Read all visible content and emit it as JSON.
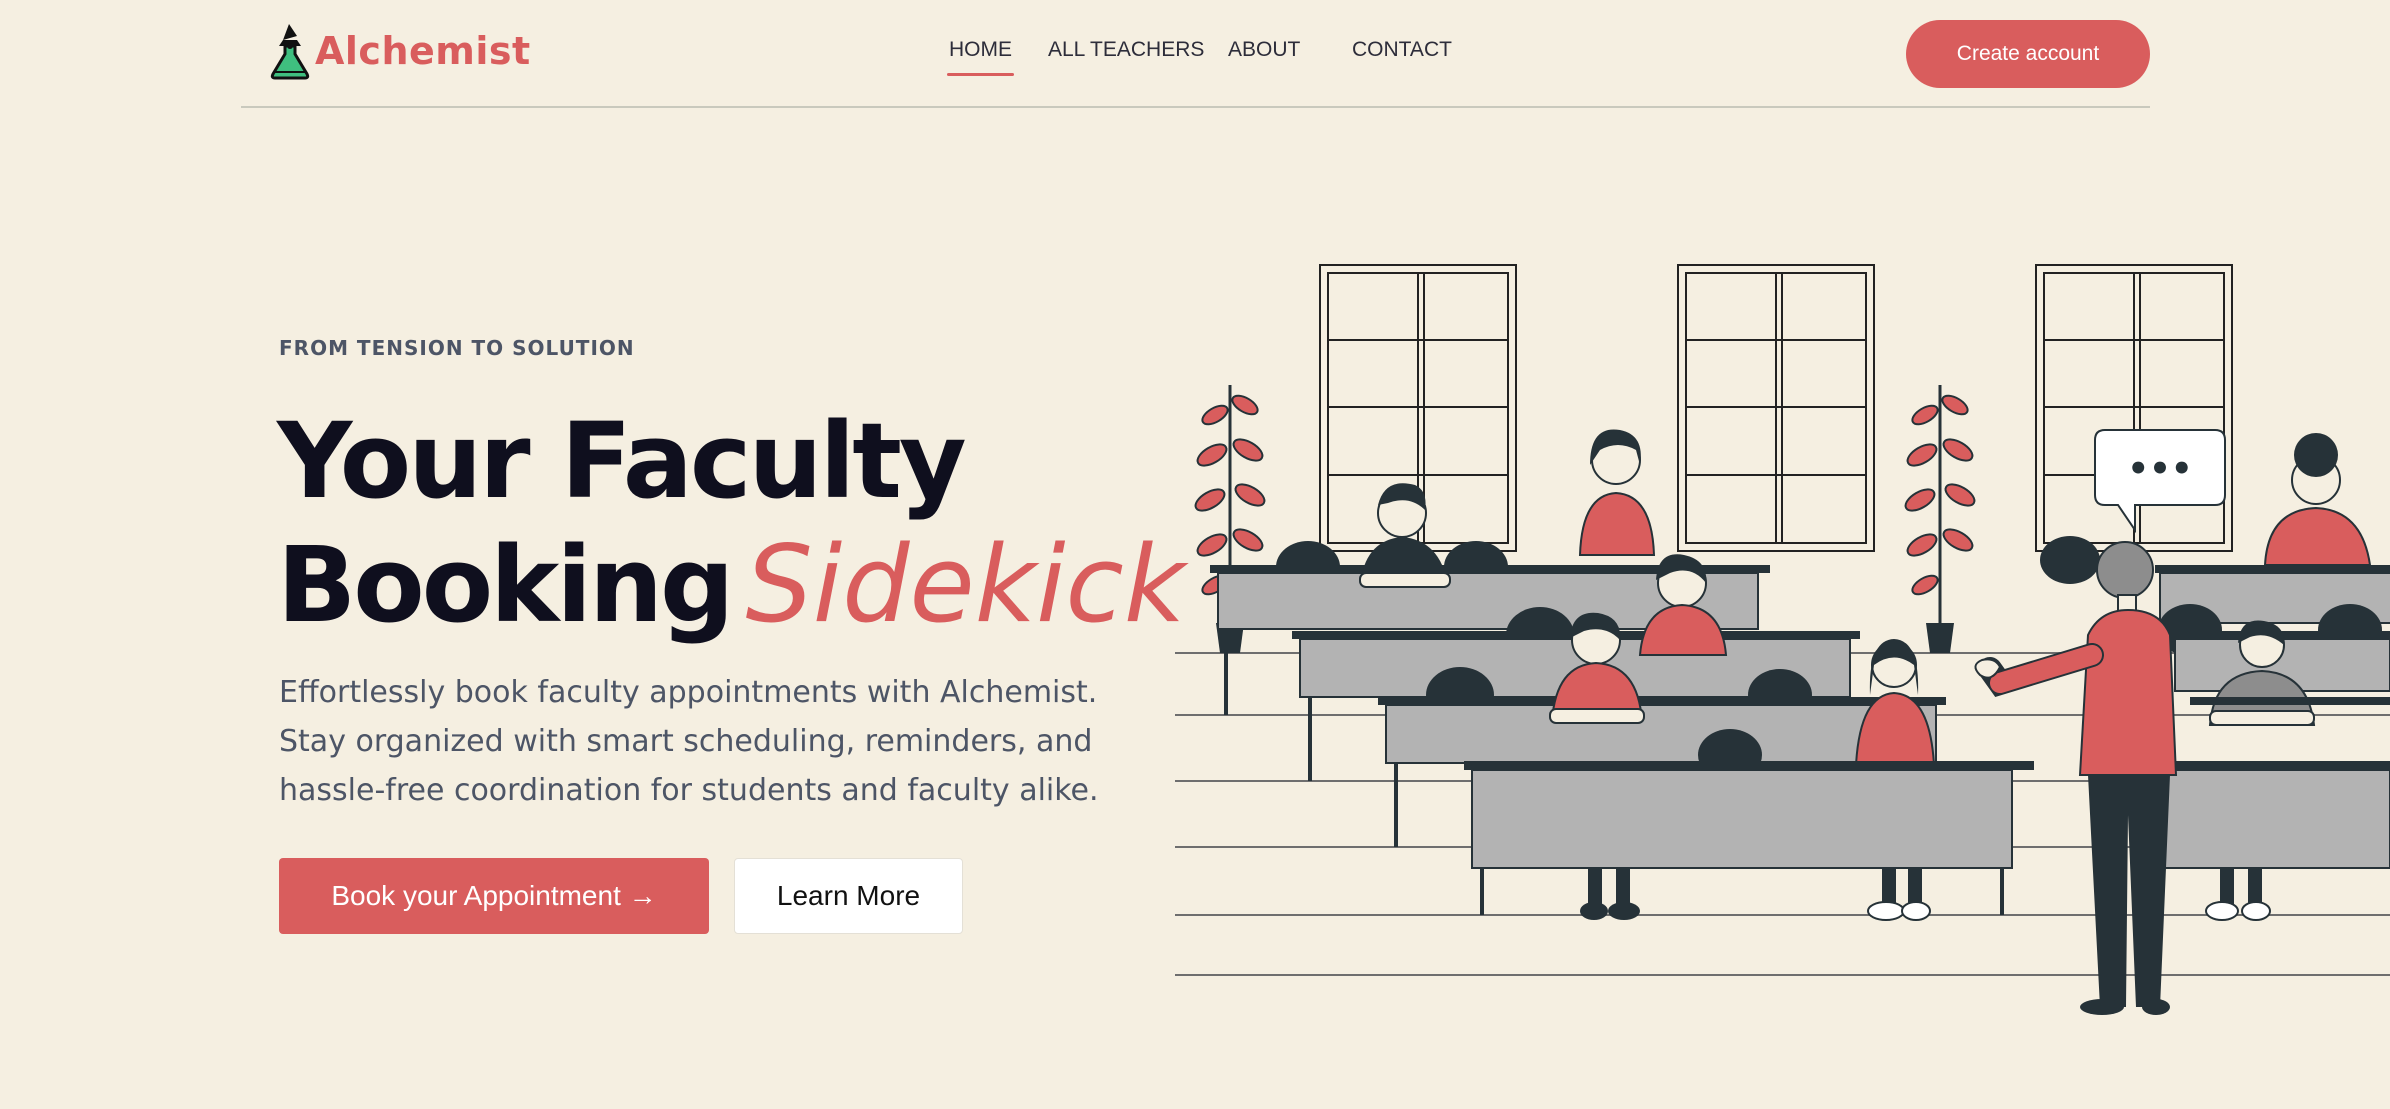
{
  "app": {
    "brand": "Alchemist"
  },
  "nav": {
    "home": "HOME",
    "teachers": "ALL TEACHERS",
    "about": "ABOUT",
    "contact": "CONTACT",
    "active": "HOME",
    "create_account": "Create account"
  },
  "hero": {
    "eyebrow": "FROM TENSION TO SOLUTION",
    "title_line1": "Your Faculty",
    "title_line2": "Booking",
    "title_accent": "Sidekick",
    "description_lines": [
      "Effortlessly book faculty appointments with Alchemist.",
      "Stay organized with smart scheduling, reminders, and",
      "hassle-free coordination for students and faculty alike."
    ],
    "primary_cta": "Book your Appointment →",
    "secondary_cta": "Learn More",
    "speech_bubble": "•••"
  },
  "colors": {
    "background": "#f5efe1",
    "accent": "#d95d5d",
    "heading": "#0f0f1e",
    "body_text": "#4d5566",
    "desk": "#b3b3b3",
    "ink": "#263238"
  },
  "icons": {
    "logo": "flask-wizard-icon",
    "arrow": "arrow-right-icon"
  }
}
